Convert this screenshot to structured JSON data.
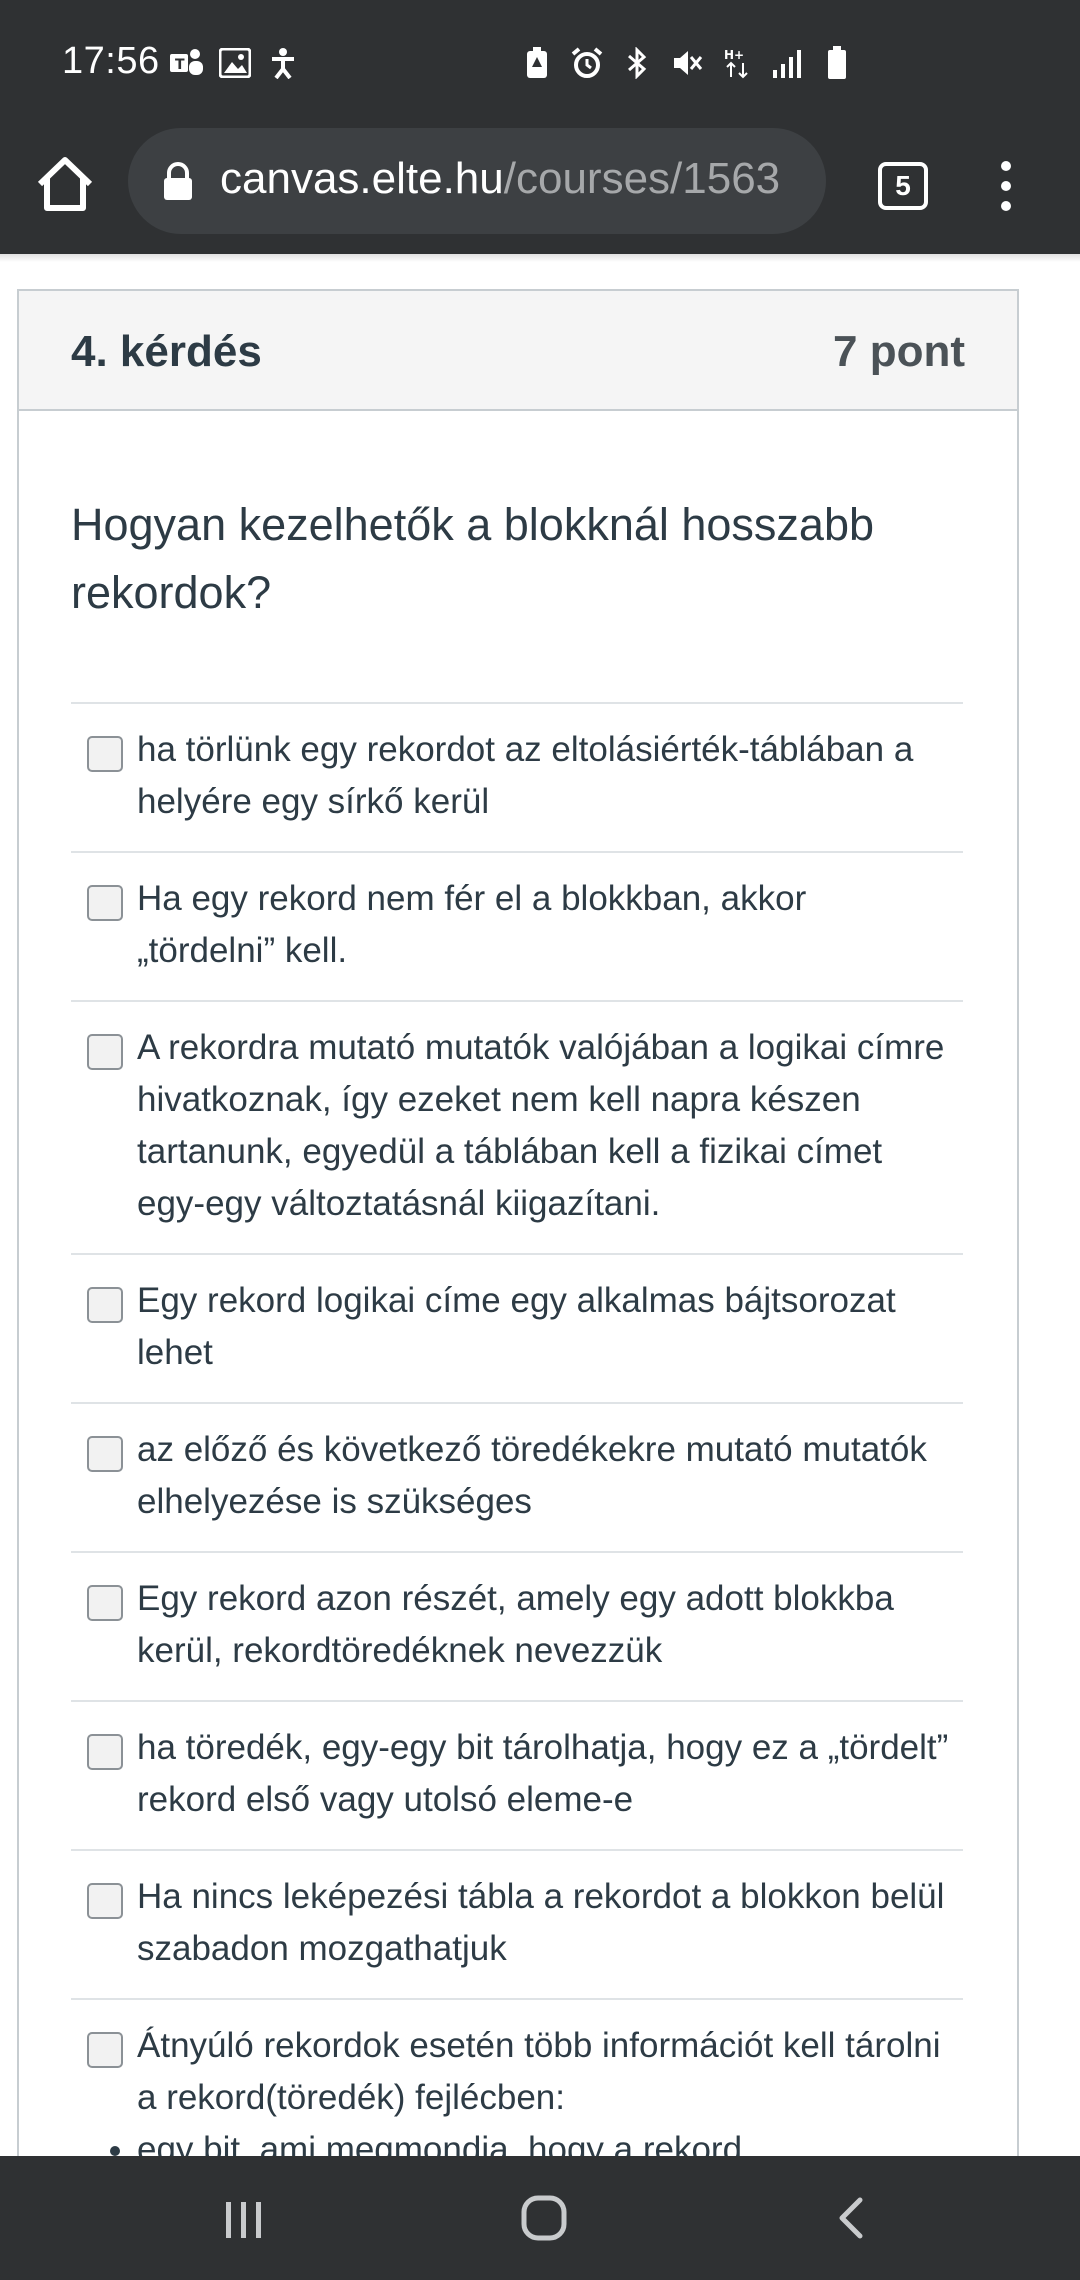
{
  "status_bar": {
    "time": "17:56",
    "left_icons": [
      "teams-icon",
      "image-icon",
      "accessibility-icon"
    ],
    "right_icons": [
      "battery-saver-icon",
      "alarm-icon",
      "bluetooth-icon",
      "mute-icon",
      "data-icon",
      "signal-icon",
      "battery-icon"
    ]
  },
  "browser": {
    "url_domain": "canvas.elte.hu",
    "url_path": "/courses/1563",
    "tab_count": "5"
  },
  "question": {
    "title": "4. kérdés",
    "points": "7 pont",
    "text": "Hogyan kezelhetők a blokknál hosszabb rekordok?",
    "answers": [
      "ha törlünk egy rekordot az eltolásiérték-táblában a helyére egy sírkő kerül",
      "Ha egy rekord nem fér el a blokkban, akkor „tördelni” kell.",
      "A rekordra mutató mutatók valójában a logikai címre hivatkoznak, így ezeket nem kell napra készen tartanunk, egyedül a táblában kell a fizikai címet egy-egy változtatásnál kiigazítani.",
      "Egy rekord logikai címe egy alkalmas bájtsorozat lehet",
      "az előző és következő töredékekre mutató mutatók elhelyezése is szükséges",
      "Egy rekord azon részét, amely egy adott blokkba kerül, rekordtöredéknek nevezzük",
      "ha töredék, egy-egy bit tárolhatja, hogy ez a „tördelt” rekord első vagy utolsó eleme-e",
      "Ha nincs leképezési tábla a rekordot a blokkon belül szabadon mozgathatjuk"
    ],
    "last_answer_bullets": [
      "Átnyúló rekordok esetén több információt kell tárolni a rekord(töredék) fejlécben:",
      "egy bit, ami megmondja, hogy a rekord"
    ]
  },
  "nav_bar": {
    "icons": [
      "recents-icon",
      "home-icon",
      "back-icon"
    ]
  }
}
